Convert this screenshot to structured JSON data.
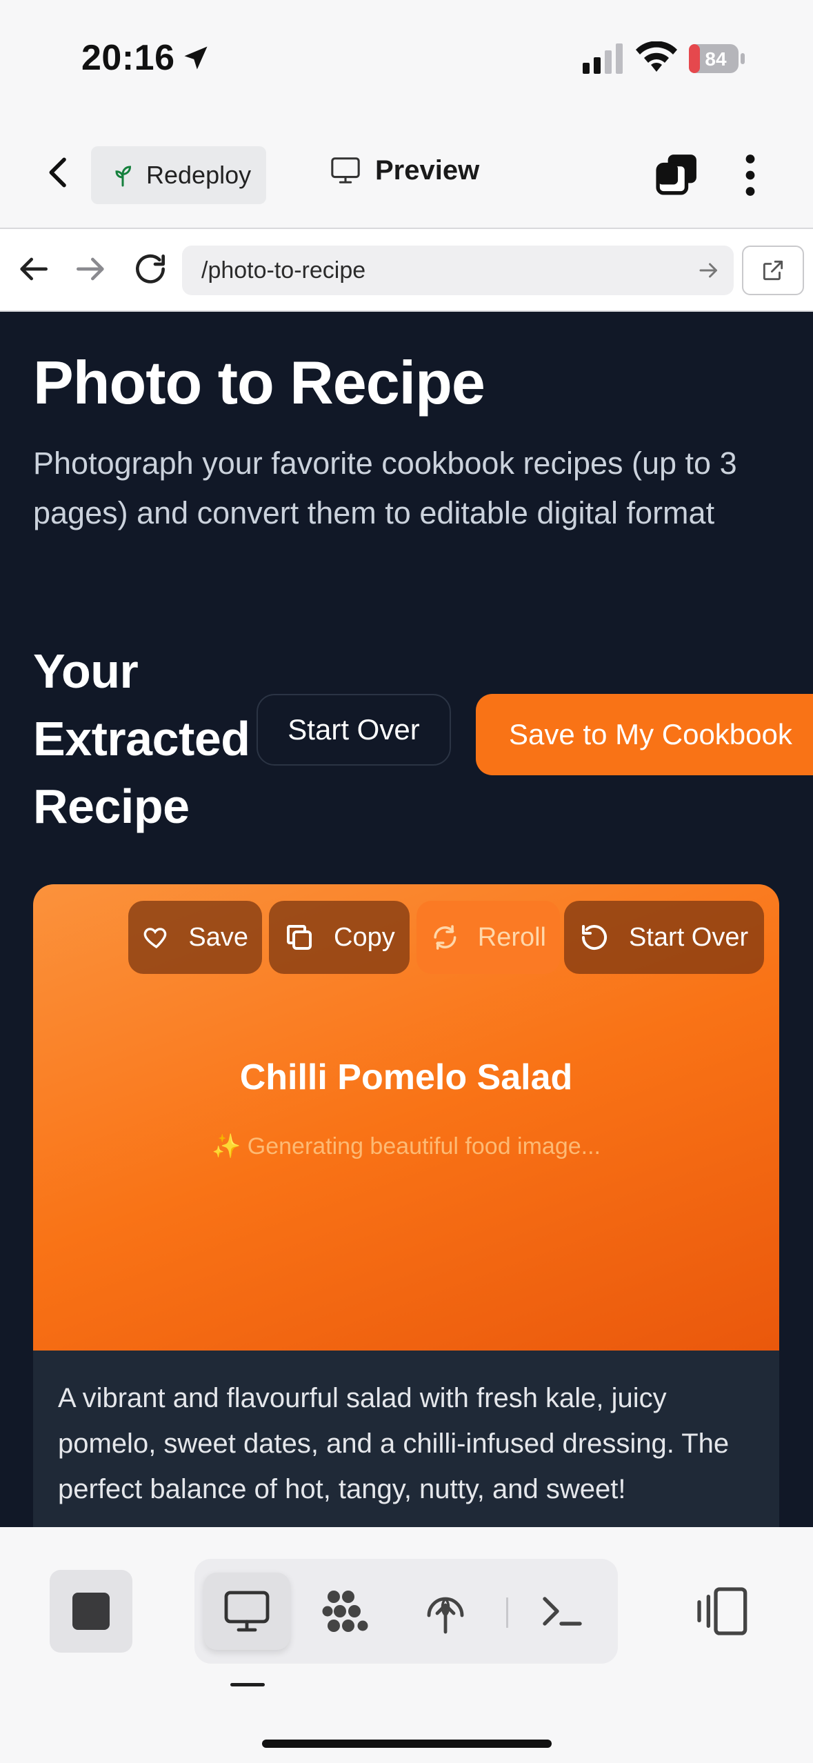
{
  "status_bar": {
    "time": "20:16",
    "battery": "84"
  },
  "header": {
    "redeploy_label": "Redeploy",
    "preview_label": "Preview"
  },
  "browser": {
    "url": "/photo-to-recipe"
  },
  "page": {
    "title": "Photo to Recipe",
    "subtitle": "Photograph your favorite cookbook recipes (up to 3 pages) and convert them to editable digital format",
    "section_heading": "Your Extracted Recipe",
    "start_over_label": "Start Over",
    "save_cookbook_label": "Save to My Cookbook"
  },
  "card": {
    "actions": {
      "save": "Save",
      "copy": "Copy",
      "reroll": "Reroll",
      "start_over": "Start Over"
    },
    "recipe_name": "Chilli Pomelo Salad",
    "generating_text": "✨ Generating beautiful food image...",
    "description": "A vibrant and flavourful salad with fresh kale, juicy pomelo, sweet dates, and a chilli-infused dressing. The perfect balance of hot, tangy, nutty, and sweet!"
  },
  "colors": {
    "accent": "#f97316",
    "dark_bg": "#111827",
    "card_body": "#1f2937"
  },
  "icons": [
    "location-arrow-icon",
    "signal-icon",
    "wifi-icon",
    "battery-icon",
    "chevron-left-icon",
    "sprout-icon",
    "monitor-icon",
    "tabs-icon",
    "more-vertical-icon",
    "arrow-left-icon",
    "arrow-right-icon",
    "reload-icon",
    "external-link-icon",
    "heart-icon",
    "copy-icon",
    "refresh-icon",
    "undo-icon",
    "stop-icon",
    "dots-grid-icon",
    "deploy-icon",
    "terminal-icon",
    "panel-icon"
  ]
}
